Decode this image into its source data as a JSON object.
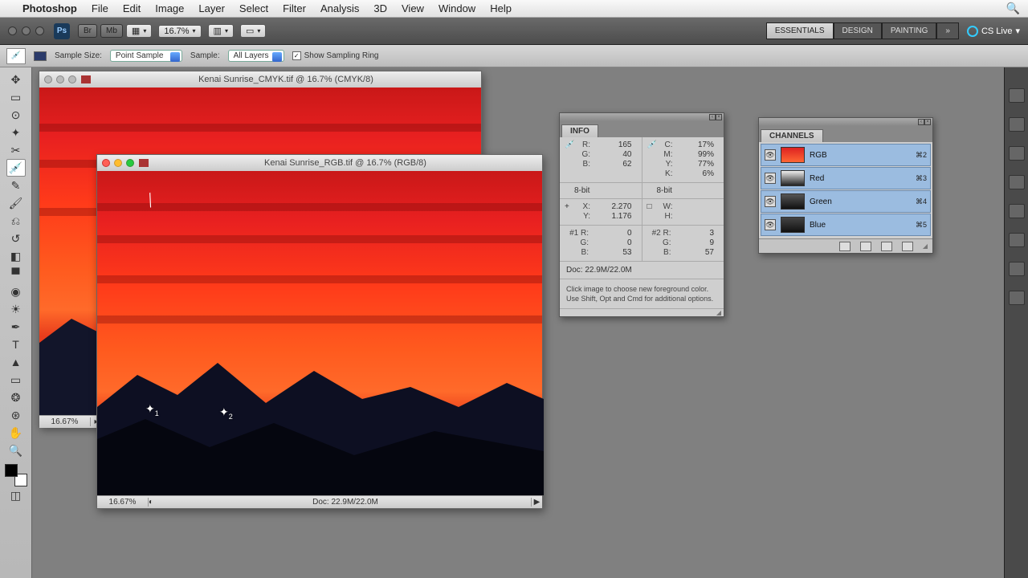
{
  "menubar": {
    "app": "Photoshop",
    "items": [
      "File",
      "Edit",
      "Image",
      "Layer",
      "Select",
      "Filter",
      "Analysis",
      "3D",
      "View",
      "Window",
      "Help"
    ]
  },
  "apptoolbar": {
    "zoom": "16.7%",
    "workspaces": [
      "ESSENTIALS",
      "DESIGN",
      "PAINTING"
    ],
    "more": "»",
    "cslive": "CS Live"
  },
  "options": {
    "sampleSizeLabel": "Sample Size:",
    "sampleSize": "Point Sample",
    "sampleLabel": "Sample:",
    "sample": "All Layers",
    "showRing": "Show Sampling Ring"
  },
  "doc1": {
    "title": "Kenai Sunrise_CMYK.tif @ 16.7% (CMYK/8)",
    "zoom": "16.67%"
  },
  "doc2": {
    "title": "Kenai Sunrise_RGB.tif @ 16.7% (RGB/8)",
    "zoom": "16.67%",
    "docsize": "Doc: 22.9M/22.0M"
  },
  "info": {
    "tab": "INFO",
    "rgb": {
      "r": "165",
      "g": "40",
      "b": "62"
    },
    "cmyk": {
      "c": "17%",
      "m": "99%",
      "y": "77%",
      "k": "6%"
    },
    "bit1": "8-bit",
    "bit2": "8-bit",
    "xy": {
      "x": "2.270",
      "y": "1.176"
    },
    "wh": {
      "w": "",
      "h": ""
    },
    "s1": {
      "label": "#1",
      "r": "0",
      "g": "0",
      "b": "53"
    },
    "s2": {
      "label": "#2",
      "r": "3",
      "g": "9",
      "b": "57"
    },
    "docline": "Doc: 22.9M/22.0M",
    "hint": "Click image to choose new foreground color. Use Shift, Opt and Cmd for additional options."
  },
  "channels": {
    "tab": "CHANNELS",
    "rows": [
      {
        "name": "RGB",
        "short": "⌘2",
        "bg": "linear-gradient(#d22,#f63)"
      },
      {
        "name": "Red",
        "short": "⌘3",
        "bg": "linear-gradient(#eee,#222)"
      },
      {
        "name": "Green",
        "short": "⌘4",
        "bg": "linear-gradient(#555,#111)"
      },
      {
        "name": "Blue",
        "short": "⌘5",
        "bg": "linear-gradient(#444,#111)"
      }
    ]
  }
}
